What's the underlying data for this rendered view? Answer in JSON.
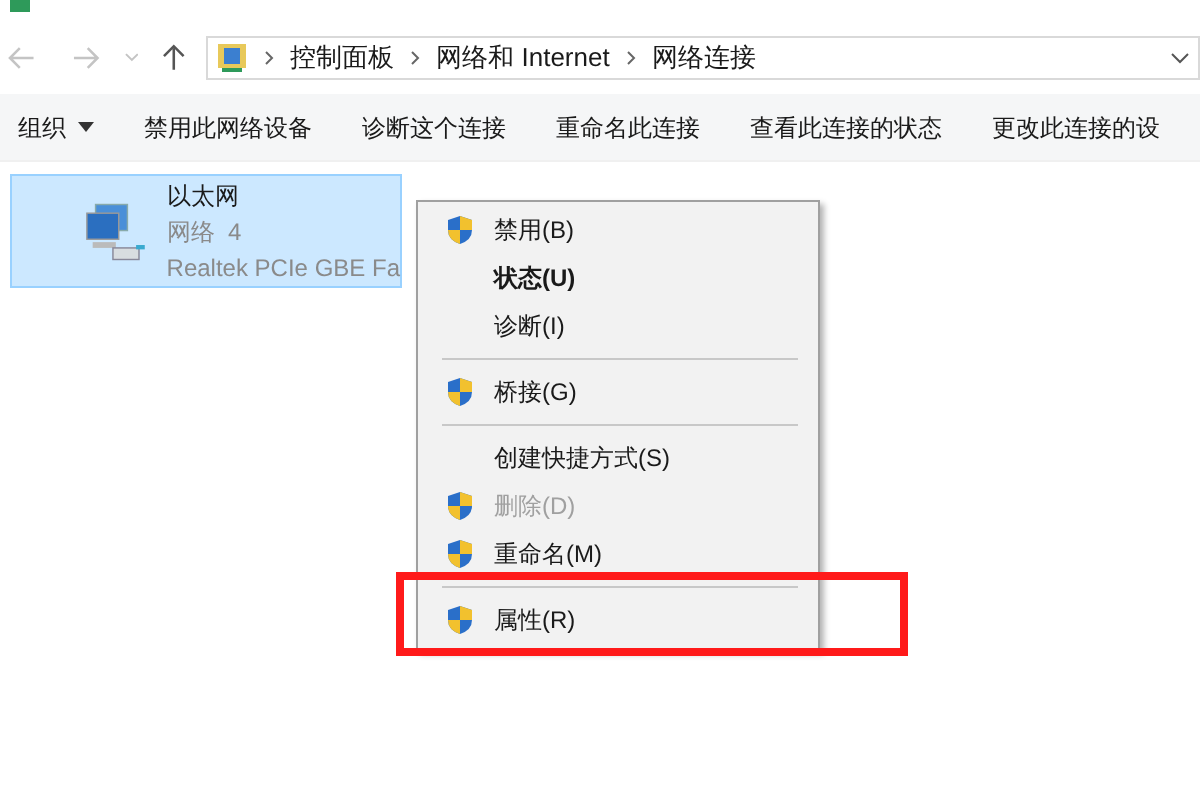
{
  "address_bar": {
    "path": [
      "控制面板",
      "网络和 Internet",
      "网络连接"
    ]
  },
  "toolbar": [
    {
      "label": "组织",
      "dropdown": true
    },
    {
      "label": "禁用此网络设备",
      "dropdown": false
    },
    {
      "label": "诊断这个连接",
      "dropdown": false
    },
    {
      "label": "重命名此连接",
      "dropdown": false
    },
    {
      "label": "查看此连接的状态",
      "dropdown": false
    },
    {
      "label": "更改此连接的设",
      "dropdown": false
    }
  ],
  "connection": {
    "name": "以太网",
    "network": "网络  4",
    "adapter": "Realtek PCIe GBE Fa",
    "selected": true
  },
  "context_menu": [
    {
      "kind": "item",
      "label": "禁用(B)",
      "shield": true,
      "bold": false,
      "disabled": false,
      "highlighted": false
    },
    {
      "kind": "item",
      "label": "状态(U)",
      "shield": false,
      "bold": true,
      "disabled": false,
      "highlighted": false
    },
    {
      "kind": "item",
      "label": "诊断(I)",
      "shield": false,
      "bold": false,
      "disabled": false,
      "highlighted": false
    },
    {
      "kind": "separator"
    },
    {
      "kind": "item",
      "label": "桥接(G)",
      "shield": true,
      "bold": false,
      "disabled": false,
      "highlighted": false
    },
    {
      "kind": "separator"
    },
    {
      "kind": "item",
      "label": "创建快捷方式(S)",
      "shield": false,
      "bold": false,
      "disabled": false,
      "highlighted": false
    },
    {
      "kind": "item",
      "label": "删除(D)",
      "shield": true,
      "bold": false,
      "disabled": true,
      "highlighted": false
    },
    {
      "kind": "item",
      "label": "重命名(M)",
      "shield": true,
      "bold": false,
      "disabled": false,
      "highlighted": false
    },
    {
      "kind": "separator"
    },
    {
      "kind": "item",
      "label": "属性(R)",
      "shield": true,
      "bold": false,
      "disabled": false,
      "highlighted": true
    }
  ]
}
